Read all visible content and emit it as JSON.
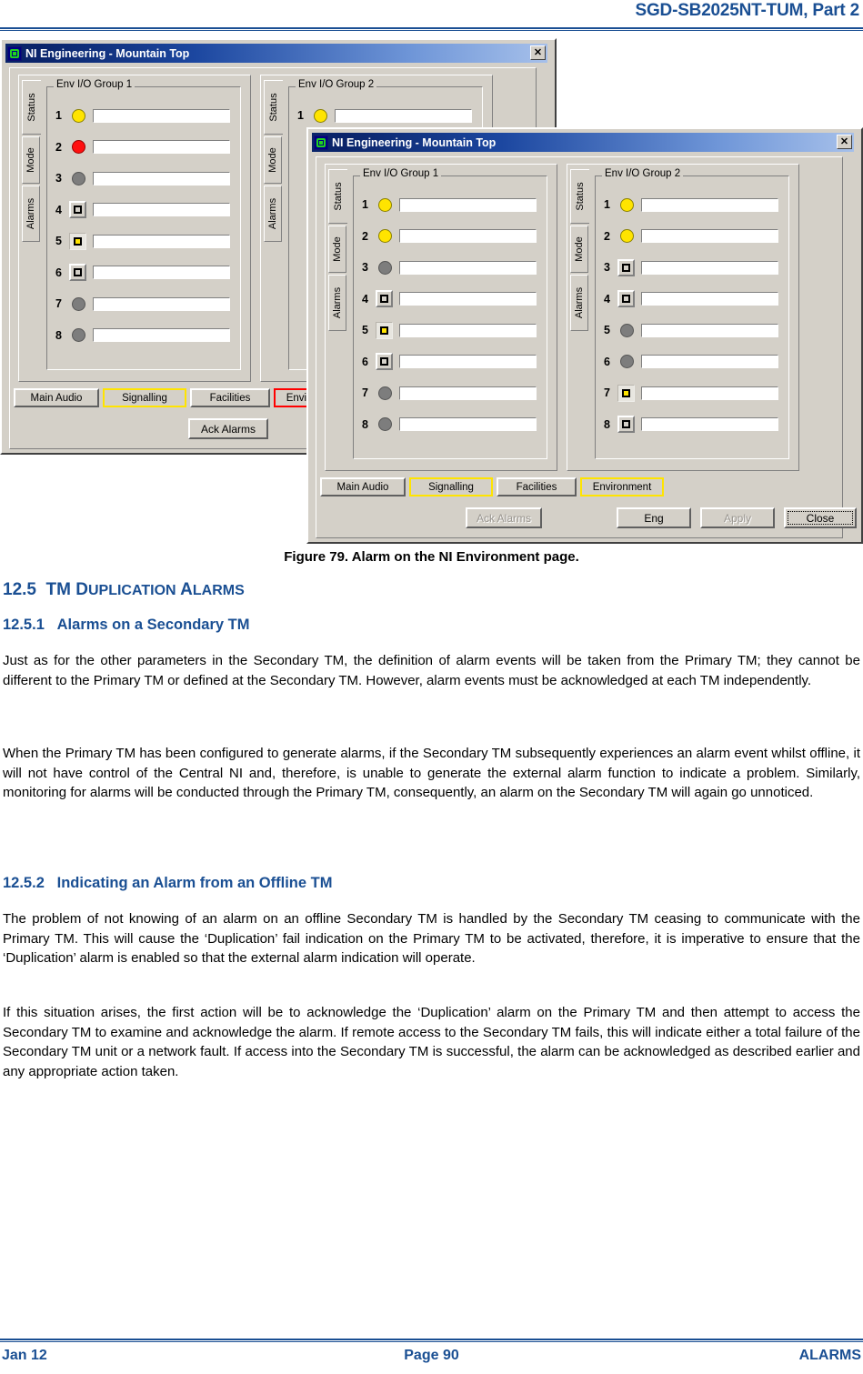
{
  "document": {
    "header_title": "SGD-SB2025NT-TUM, Part 2",
    "figure_caption": "Figure 79.  Alarm on the NI Environment page.",
    "section_number": "12.5",
    "section_title_first": "TM D",
    "section_title_rest": "UPLICATION",
    "section_title_a": " A",
    "section_title_larms": "LARMS",
    "section_title_full": "TM DUPLICATION ALARMS",
    "sub1_number": "12.5.1",
    "sub1_title": "Alarms on a Secondary TM",
    "para1": "Just as for the other parameters in the Secondary TM, the definition of alarm events will be taken from the Primary TM; they cannot be different to the Primary TM or defined at the Secondary TM.  However, alarm events must be acknowledged at each TM independently.",
    "para2": "When the Primary TM has been configured to generate alarms, if the Secondary TM subsequently experiences an alarm event whilst offline, it will not have control of the Central NI and, therefore, is unable to generate the external alarm function to indicate a problem.   Similarly, monitoring for alarms will be conducted through the Primary TM, consequently, an alarm on the Secondary TM will again go unnoticed.",
    "sub2_number": "12.5.2",
    "sub2_title": "Indicating an Alarm from an Offline TM",
    "para3": "The problem of not knowing of an alarm on an offline Secondary TM is handled by the Secondary TM ceasing to communicate with the Primary TM.  This will cause the ‘Duplication’ fail indication on the Primary TM to be activated, therefore, it is imperative to ensure that the ‘Duplication’ alarm is enabled so that the external alarm indication will operate.",
    "para4": "If this situation arises, the first action will be to acknowledge the ‘Duplication’ alarm on the Primary TM and then attempt to access the Secondary TM to examine and acknowledge the alarm.   If remote access to the Secondary TM fails, this will indicate either a total failure of the Secondary TM unit or a network fault.   If access into the Secondary TM is successful, the alarm can be acknowledged as described earlier and any appropriate action taken.",
    "footer_left": "Jan 12",
    "footer_center": "Page 90",
    "footer_right": "ALARMS"
  },
  "colors": {
    "brand_blue": "#1a4f93",
    "titlebar_blue": "#0a246a",
    "dialog_face": "#d4d0c8",
    "lamp_yellow": "#ffe400",
    "lamp_red": "#ff1010",
    "lamp_grey": "#7d7d7d",
    "highlight_yellow": "#ffe400",
    "alarm_red": "#ff0000"
  },
  "window_back": {
    "title": "NI Engineering - Mountain Top",
    "close_label": "✕",
    "vtabs": [
      "Status",
      "Mode",
      "Alarms"
    ],
    "selected_vtab": "Status",
    "group1": {
      "title": "Env I/O Group 1",
      "rows": [
        {
          "num": "1",
          "indicator": "lamp-yellow",
          "value": ""
        },
        {
          "num": "2",
          "indicator": "lamp-red",
          "value": ""
        },
        {
          "num": "3",
          "indicator": "lamp-grey",
          "value": ""
        },
        {
          "num": "4",
          "indicator": "button-off",
          "value": ""
        },
        {
          "num": "5",
          "indicator": "button-on",
          "value": ""
        },
        {
          "num": "6",
          "indicator": "button-off",
          "value": ""
        },
        {
          "num": "7",
          "indicator": "lamp-grey",
          "value": ""
        },
        {
          "num": "8",
          "indicator": "lamp-grey",
          "value": ""
        }
      ]
    },
    "group2": {
      "title": "Env I/O Group 2",
      "rows": [
        {
          "num": "1",
          "indicator": "lamp-yellow",
          "value": ""
        }
      ]
    },
    "tabs": [
      {
        "label": "Main Audio",
        "state": "normal"
      },
      {
        "label": "Signalling",
        "state": "highlight-yellow"
      },
      {
        "label": "Facilities",
        "state": "normal"
      },
      {
        "label": "Environment",
        "state": "highlight-red"
      }
    ],
    "buttons": [
      {
        "label": "Ack Alarms",
        "state": "enabled"
      }
    ]
  },
  "window_front": {
    "title": "NI Engineering - Mountain Top",
    "close_label": "✕",
    "vtabs": [
      "Status",
      "Mode",
      "Alarms"
    ],
    "selected_vtab": "Status",
    "group1": {
      "title": "Env I/O Group 1",
      "rows": [
        {
          "num": "1",
          "indicator": "lamp-yellow",
          "value": ""
        },
        {
          "num": "2",
          "indicator": "lamp-yellow",
          "value": ""
        },
        {
          "num": "3",
          "indicator": "lamp-grey",
          "value": ""
        },
        {
          "num": "4",
          "indicator": "button-off",
          "value": ""
        },
        {
          "num": "5",
          "indicator": "button-on",
          "value": ""
        },
        {
          "num": "6",
          "indicator": "button-off",
          "value": ""
        },
        {
          "num": "7",
          "indicator": "lamp-grey",
          "value": ""
        },
        {
          "num": "8",
          "indicator": "lamp-grey",
          "value": ""
        }
      ]
    },
    "group2": {
      "title": "Env I/O Group 2",
      "rows": [
        {
          "num": "1",
          "indicator": "lamp-yellow",
          "value": ""
        },
        {
          "num": "2",
          "indicator": "lamp-yellow",
          "value": ""
        },
        {
          "num": "3",
          "indicator": "button-off",
          "value": ""
        },
        {
          "num": "4",
          "indicator": "button-off",
          "value": ""
        },
        {
          "num": "5",
          "indicator": "lamp-grey",
          "value": ""
        },
        {
          "num": "6",
          "indicator": "lamp-grey",
          "value": ""
        },
        {
          "num": "7",
          "indicator": "button-on",
          "value": ""
        },
        {
          "num": "8",
          "indicator": "button-off",
          "value": ""
        }
      ]
    },
    "tabs": [
      {
        "label": "Main Audio",
        "state": "normal"
      },
      {
        "label": "Signalling",
        "state": "highlight-yellow"
      },
      {
        "label": "Facilities",
        "state": "normal"
      },
      {
        "label": "Environment",
        "state": "highlight-yellow"
      }
    ],
    "buttons": [
      {
        "label": "Ack Alarms",
        "state": "disabled"
      },
      {
        "label": "Eng",
        "state": "enabled"
      },
      {
        "label": "Apply",
        "state": "disabled"
      },
      {
        "label": "Close",
        "state": "default"
      }
    ]
  }
}
